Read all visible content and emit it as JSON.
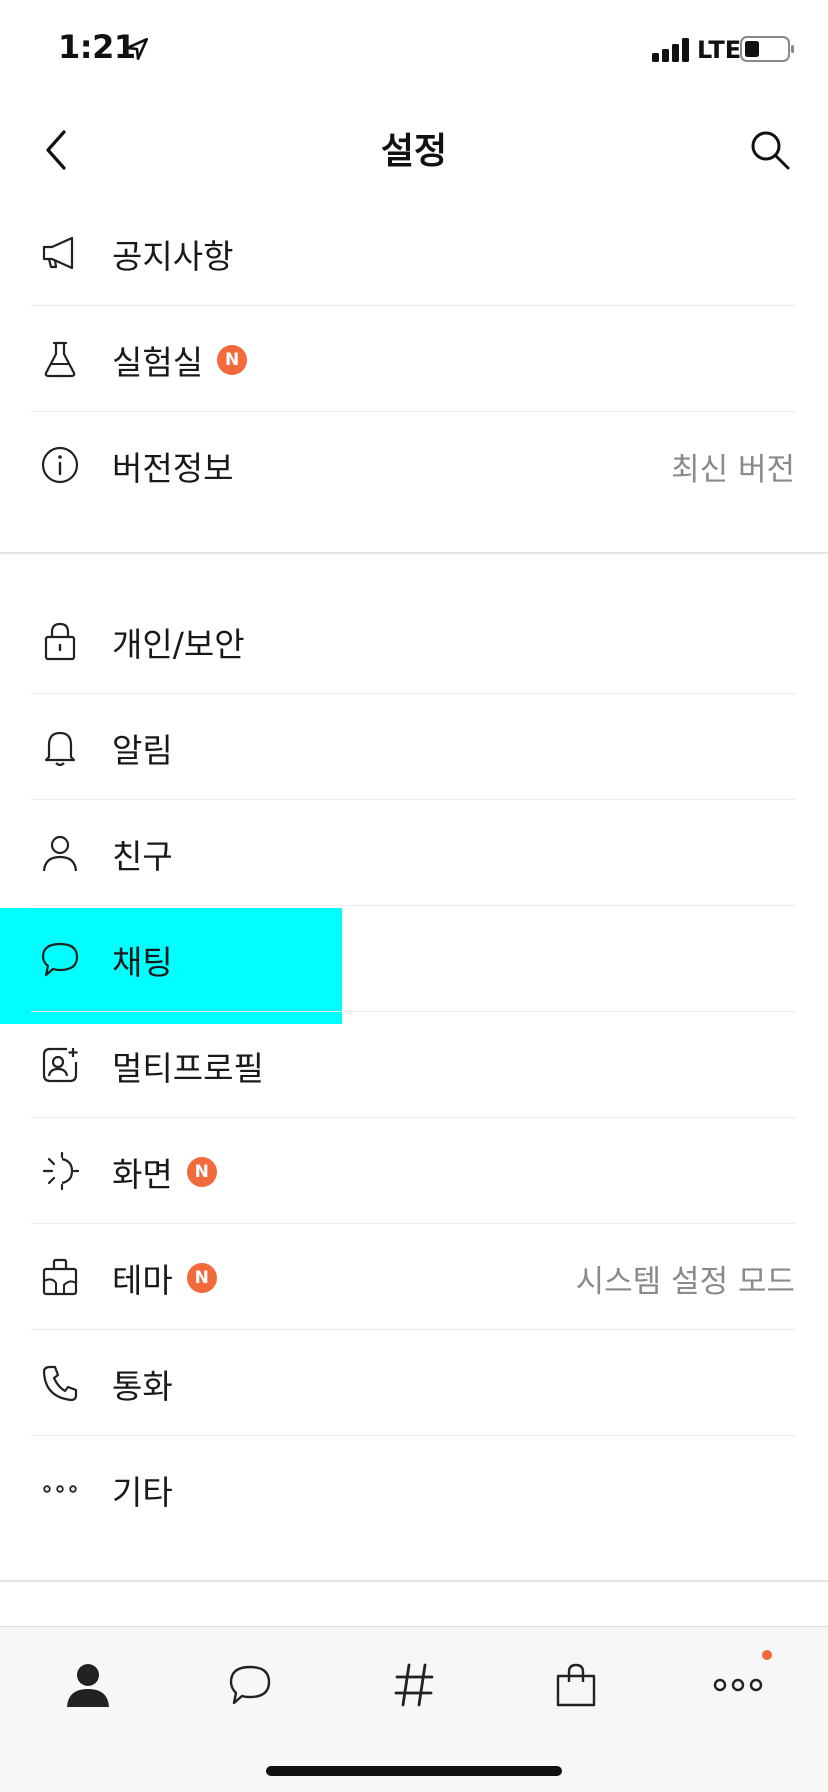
{
  "status_bar": {
    "time": "1:21",
    "network": "LTE"
  },
  "header": {
    "title": "설정"
  },
  "section1": [
    {
      "label": "공지사항",
      "icon": "megaphone-icon"
    },
    {
      "label": "실험실",
      "icon": "flask-icon",
      "badge": "N"
    },
    {
      "label": "버전정보",
      "icon": "info-icon",
      "value": "최신 버전"
    }
  ],
  "section2": [
    {
      "label": "개인/보안",
      "icon": "lock-icon"
    },
    {
      "label": "알림",
      "icon": "bell-icon"
    },
    {
      "label": "친구",
      "icon": "person-icon"
    },
    {
      "label": "채팅",
      "icon": "chat-bubble-icon"
    },
    {
      "label": "멀티프로필",
      "icon": "multi-profile-icon"
    },
    {
      "label": "화면",
      "icon": "display-icon",
      "badge": "N"
    },
    {
      "label": "테마",
      "icon": "theme-icon",
      "badge": "N",
      "value": "시스템 설정 모드"
    },
    {
      "label": "통화",
      "icon": "phone-icon"
    },
    {
      "label": "기타",
      "icon": "more-dots-icon"
    }
  ],
  "tab_bar": {
    "tabs": [
      {
        "icon": "friends-tab-icon"
      },
      {
        "icon": "chats-tab-icon"
      },
      {
        "icon": "hashtag-tab-icon"
      },
      {
        "icon": "shopping-tab-icon"
      },
      {
        "icon": "more-tab-icon"
      }
    ]
  },
  "colors": {
    "badge": "#f06a3b",
    "highlight": "#00ffff",
    "secondary_text": "#8a8a8a"
  }
}
